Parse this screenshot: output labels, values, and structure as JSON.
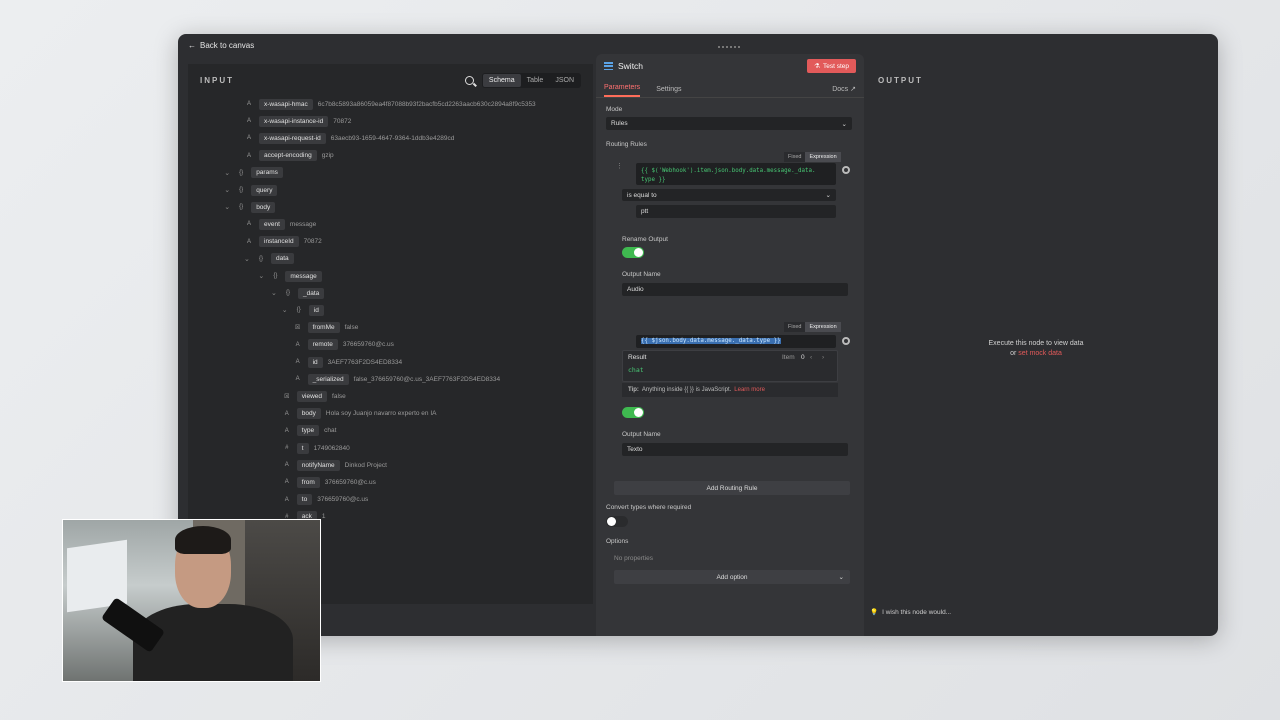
{
  "topbar": {
    "back_label": "Back to canvas"
  },
  "input": {
    "title": "INPUT",
    "tabs": [
      "Schema",
      "Table",
      "JSON"
    ],
    "rows": [
      {
        "type": "A",
        "key": "x-wasapi-hmac",
        "value": "6c7b8c5893a86059ea4f87088b93f2bacfb5cd2263aacb630c2894a8f9c5353",
        "depth": 2
      },
      {
        "type": "A",
        "key": "x-wasapi-instance-id",
        "value": "70872",
        "depth": 2
      },
      {
        "type": "A",
        "key": "x-wasapi-request-id",
        "value": "63aecb93-1659-4647-9364-1ddb3e4289cd",
        "depth": 2
      },
      {
        "type": "A",
        "key": "accept-encoding",
        "value": "gzip",
        "depth": 2
      },
      {
        "type": "{}",
        "key": "params",
        "value": "",
        "depth": 1,
        "caret": true
      },
      {
        "type": "{}",
        "key": "query",
        "value": "",
        "depth": 1,
        "caret": true
      },
      {
        "type": "{}",
        "key": "body",
        "value": "",
        "depth": 1,
        "caret": true
      },
      {
        "type": "A",
        "key": "event",
        "value": "message",
        "depth": 2
      },
      {
        "type": "A",
        "key": "instanceId",
        "value": "70872",
        "depth": 2
      },
      {
        "type": "{}",
        "key": "data",
        "value": "",
        "depth": 2,
        "caret": true
      },
      {
        "type": "{}",
        "key": "message",
        "value": "",
        "depth": 3,
        "caret": true
      },
      {
        "type": "{}",
        "key": "_data",
        "value": "",
        "depth": 4,
        "caret": true
      },
      {
        "type": "{}",
        "key": "id",
        "value": "",
        "depth": 5,
        "caret": true
      },
      {
        "type": "☒",
        "key": "fromMe",
        "value": "false",
        "depth": 6
      },
      {
        "type": "A",
        "key": "remote",
        "value": "376659760@c.us",
        "depth": 6
      },
      {
        "type": "A",
        "key": "id",
        "value": "3AEF7763F2DS4ED8334",
        "depth": 6
      },
      {
        "type": "A",
        "key": "_serialized",
        "value": "false_376659760@c.us_3AEF7763F2DS4ED8334",
        "depth": 6
      },
      {
        "type": "☒",
        "key": "viewed",
        "value": "false",
        "depth": 5
      },
      {
        "type": "A",
        "key": "body",
        "value": "Hola soy Juanjo navarro experto en IA",
        "depth": 5
      },
      {
        "type": "A",
        "key": "type",
        "value": "chat",
        "depth": 5
      },
      {
        "type": "#",
        "key": "t",
        "value": "1749062840",
        "depth": 5
      },
      {
        "type": "A",
        "key": "notifyName",
        "value": "Dinkod Project",
        "depth": 5
      },
      {
        "type": "A",
        "key": "from",
        "value": "376659760@c.us",
        "depth": 5
      },
      {
        "type": "A",
        "key": "to",
        "value": "376659760@c.us",
        "depth": 5
      },
      {
        "type": "#",
        "key": "ack",
        "value": "1",
        "depth": 5
      },
      {
        "type": "",
        "key": "",
        "value": "true",
        "depth": 5
      },
      {
        "type": "",
        "key": "",
        "value": "",
        "depth": 5
      },
      {
        "type": "",
        "key": "",
        "value": "false",
        "depth": 5
      },
      {
        "type": "",
        "key": "",
        "value": "true",
        "depth": 5
      }
    ]
  },
  "dialog": {
    "title": "Switch",
    "test_step": "Test step",
    "tab_parameters": "Parameters",
    "tab_settings": "Settings",
    "docs": "Docs",
    "mode_label": "Mode",
    "mode_value": "Rules",
    "routing_label": "Routing Rules",
    "fixed": "Fixed",
    "expression": "Expression",
    "rule1_expr_line1": "{{ $('Webhook').item.json.body.data.message._data.",
    "rule1_expr_line2": "type }}",
    "rule1_op": "is equal to",
    "rule1_value": "ptt",
    "rename_output_label": "Rename Output",
    "output_name_label": "Output Name",
    "output1_name": "Audio",
    "rule2_expr": "{{ $json.body.data.message._data.type }}",
    "result_label": "Result",
    "result_value": "chat",
    "item_label": "Item",
    "item_index": "0",
    "tip_prefix": "Tip:",
    "tip_text": "Anything inside {{ }} is JavaScript.",
    "tip_link": "Learn more",
    "output2_name_label": "Output Name",
    "output2_name": "Texto",
    "add_rule": "Add Routing Rule",
    "convert_label": "Convert types where required",
    "options_label": "Options",
    "no_props": "No properties",
    "add_option": "Add option"
  },
  "output": {
    "title": "OUTPUT",
    "msg_line1": "Execute this node to view data",
    "msg_or": "or",
    "msg_link": "set mock data",
    "wish": "I wish this node would..."
  }
}
